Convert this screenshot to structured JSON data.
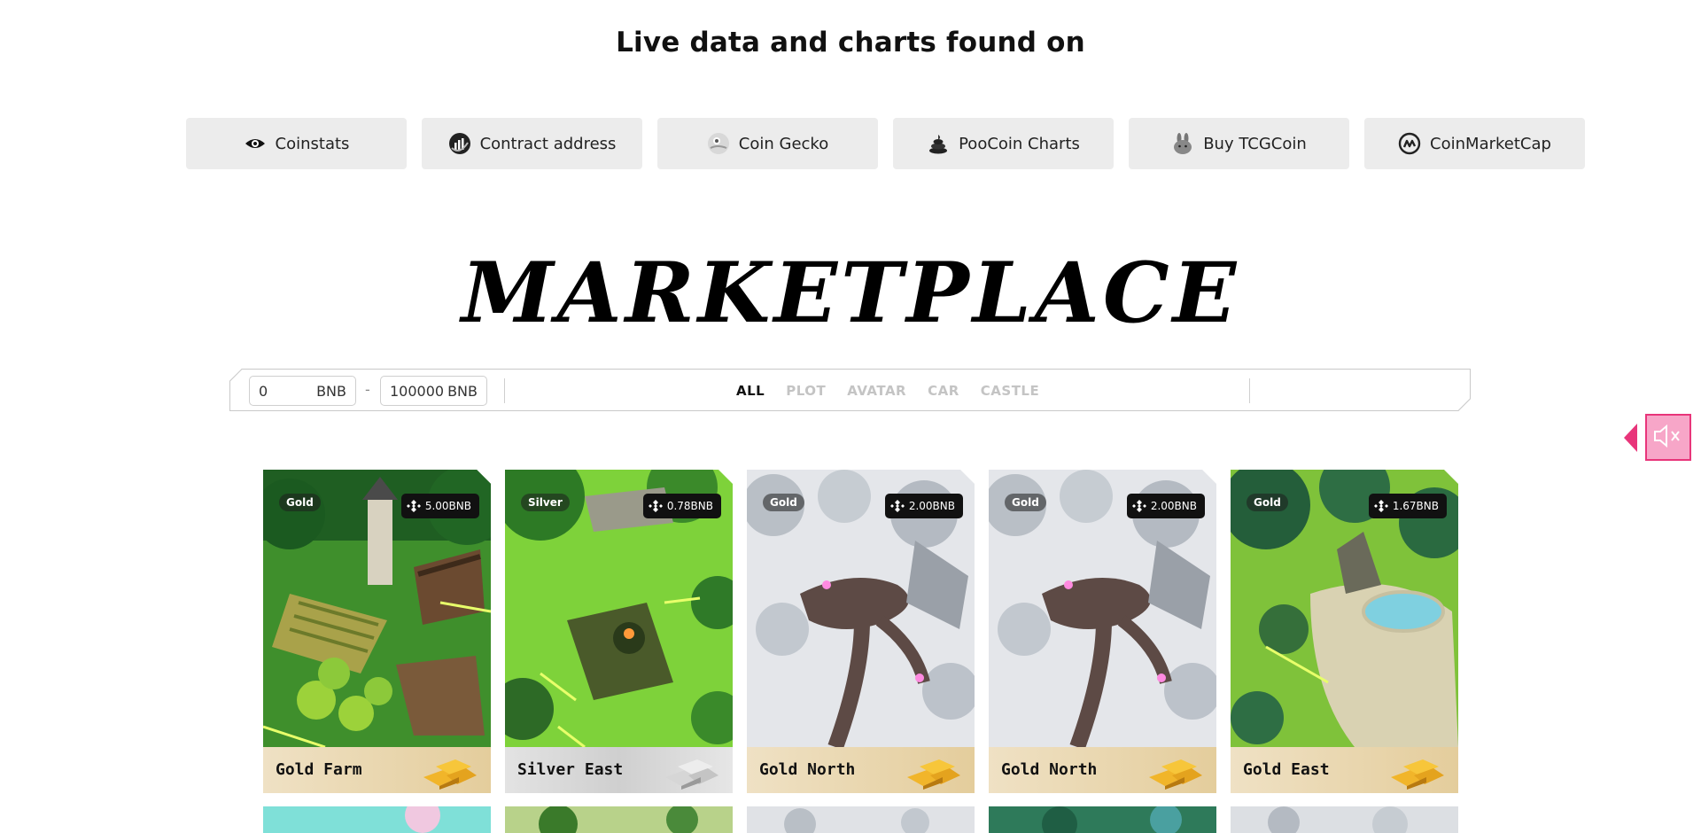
{
  "headline": "Live data and charts found on",
  "links": [
    {
      "label": "Coinstats",
      "icon": "eye-icon"
    },
    {
      "label": "Contract address",
      "icon": "bscscan-icon"
    },
    {
      "label": "Coin Gecko",
      "icon": "coingecko-icon"
    },
    {
      "label": "PooCoin Charts",
      "icon": "poocoin-icon"
    },
    {
      "label": "Buy TCGCoin",
      "icon": "pancakeswap-bunny-icon"
    },
    {
      "label": "CoinMarketCap",
      "icon": "coinmarketcap-icon"
    }
  ],
  "marketplace_title": "MARKETPLACE",
  "filter": {
    "min_value": "0",
    "min_unit": "BNB",
    "dash": "-",
    "max_value": "100000",
    "max_unit": "BNB",
    "tabs": [
      "ALL",
      "PLOT",
      "AVATAR",
      "CAR",
      "CASTLE"
    ],
    "active_tab": "ALL"
  },
  "cards": [
    {
      "name": "Gold Farm",
      "tier": "Gold",
      "price": "5.00BNB",
      "theme": "farm"
    },
    {
      "name": "Silver East",
      "tier": "Silver",
      "price": "0.78BNB",
      "theme": "meadow"
    },
    {
      "name": "Gold North",
      "tier": "Gold",
      "price": "2.00BNB",
      "theme": "snow"
    },
    {
      "name": "Gold North",
      "tier": "Gold",
      "price": "2.00BNB",
      "theme": "snow"
    },
    {
      "name": "Gold East",
      "tier": "Gold",
      "price": "1.67BNB",
      "theme": "pond"
    }
  ],
  "colors": {
    "accent": "#c8924a",
    "sound_bg": "#f7a6c8",
    "sound_border": "#e8357a"
  }
}
